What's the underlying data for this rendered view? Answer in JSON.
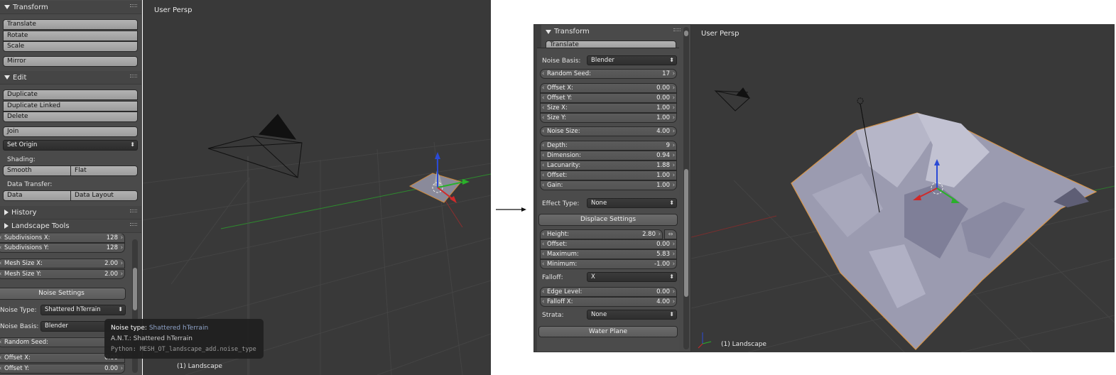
{
  "left": {
    "transform": {
      "title": "Transform",
      "items": [
        "Translate",
        "Rotate",
        "Scale"
      ],
      "mirror": "Mirror"
    },
    "edit": {
      "title": "Edit",
      "items": [
        "Duplicate",
        "Duplicate Linked",
        "Delete"
      ],
      "join": "Join",
      "set_origin": "Set Origin",
      "shading_label": "Shading:",
      "smooth": "Smooth",
      "flat": "Flat",
      "data_transfer_label": "Data Transfer:",
      "data": "Data",
      "data_layout": "Data Layout"
    },
    "history": "History",
    "landscape_tools": "Landscape Tools",
    "fields": {
      "subdiv_x": {
        "label": "Subdivisions X:",
        "value": "128"
      },
      "subdiv_y": {
        "label": "Subdivisions Y:",
        "value": "128"
      },
      "mesh_x": {
        "label": "Mesh Size X:",
        "value": "2.00"
      },
      "mesh_y": {
        "label": "Mesh Size Y:",
        "value": "2.00"
      }
    },
    "noise_settings": "Noise Settings",
    "noise_type": {
      "label": "Noise Type:",
      "value": "Shattered hTerrain"
    },
    "noise_basis": {
      "label": "Noise Basis:",
      "value": "Blender"
    },
    "random_seed": {
      "label": "Random Seed:"
    },
    "offset_x": {
      "label": "Offset X:",
      "value": "0.00"
    },
    "offset_y": {
      "label": "Offset Y:",
      "value": "0.00"
    },
    "tooltip": {
      "title_key": "Noise type:",
      "title_val": "Shattered hTerrain",
      "line2": "A.N.T.: Shattered hTerrain",
      "python": "Python: MESH_OT_landscape_add.noise_type"
    },
    "viewport": {
      "label": "User Persp",
      "object": "(1) Landscape"
    }
  },
  "right": {
    "transform_title": "Transform",
    "translate": "Translate",
    "noise_basis": {
      "label": "Noise Basis:",
      "value": "Blender"
    },
    "random_seed": {
      "label": "Random Seed:",
      "value": "17"
    },
    "group1": [
      {
        "label": "Offset X:",
        "value": "0.00"
      },
      {
        "label": "Offset Y:",
        "value": "0.00"
      },
      {
        "label": "Size X:",
        "value": "1.00"
      },
      {
        "label": "Size Y:",
        "value": "1.00"
      }
    ],
    "noise_size": {
      "label": "Noise Size:",
      "value": "4.00"
    },
    "group2": [
      {
        "label": "Depth:",
        "value": "9"
      },
      {
        "label": "Dimension:",
        "value": "0.94"
      },
      {
        "label": "Lacunarity:",
        "value": "1.88"
      },
      {
        "label": "Offset:",
        "value": "1.00"
      },
      {
        "label": "Gain:",
        "value": "1.00"
      }
    ],
    "effect_type": {
      "label": "Effect Type:",
      "value": "None"
    },
    "displace_settings": "Displace Settings",
    "group3": [
      {
        "label": "Height:",
        "value": "2.80"
      },
      {
        "label": "Offset:",
        "value": "0.00"
      },
      {
        "label": "Maximum:",
        "value": "5.83"
      },
      {
        "label": "Minimum:",
        "value": "-1.00"
      }
    ],
    "falloff": {
      "label": "Falloff:",
      "value": "X"
    },
    "group4": [
      {
        "label": "Edge Level:",
        "value": "0.00"
      },
      {
        "label": "Falloff X:",
        "value": "4.00"
      }
    ],
    "strata": {
      "label": "Strata:",
      "value": "None"
    },
    "water_plane": "Water Plane",
    "viewport": {
      "label": "User Persp",
      "object": "(1) Landscape"
    }
  },
  "arrow": "→"
}
